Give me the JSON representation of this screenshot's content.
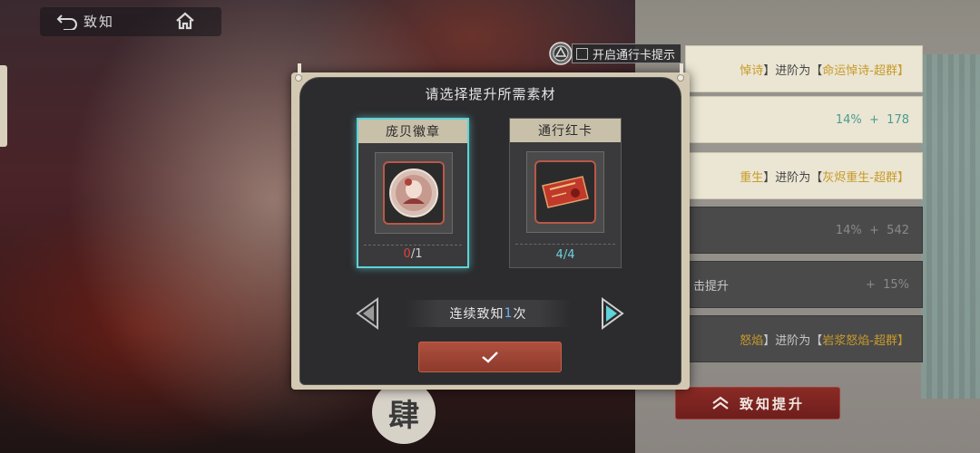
{
  "topbar": {
    "back_label": "致知",
    "home_icon": "home-icon"
  },
  "pass_toggle": {
    "label": "开启通行卡提示",
    "checked": false
  },
  "dialog": {
    "title": "请选择提升所需素材",
    "materials": [
      {
        "name": "庞贝徽章",
        "owned": "0",
        "required": "/1",
        "selected": true,
        "icon": "badge-portrait-icon"
      },
      {
        "name": "通行红卡",
        "owned": "4",
        "required": "/4",
        "selected": false,
        "icon": "red-pass-card-icon"
      }
    ],
    "stepper": {
      "prefix": "连续致知",
      "count": "1",
      "suffix": "次"
    },
    "confirm_icon": "checkmark-icon"
  },
  "right_panel": {
    "rows": [
      {
        "before": "悼诗",
        "mid": "】进阶为【",
        "after": "命运悼诗-超群】"
      },
      {
        "value": "14%",
        "plus": "+",
        "bonus": "178"
      },
      {
        "before": "重生",
        "mid": "】进阶为【",
        "after": "灰烬重生-超群】"
      },
      {
        "value": "14%",
        "plus": "+",
        "bonus": "542"
      },
      {
        "label": "击提升",
        "plus": "+",
        "bonus": "15%"
      },
      {
        "before": "怒焰",
        "mid": "】进阶为【",
        "after": "岩浆怒焰-超群】"
      }
    ],
    "upgrade_label": "致知提升"
  },
  "watermark_char": "肆",
  "colors": {
    "accent_teal": "#5ed3d8",
    "confirm_red": "#9d4536",
    "count_red": "#e0413a"
  }
}
